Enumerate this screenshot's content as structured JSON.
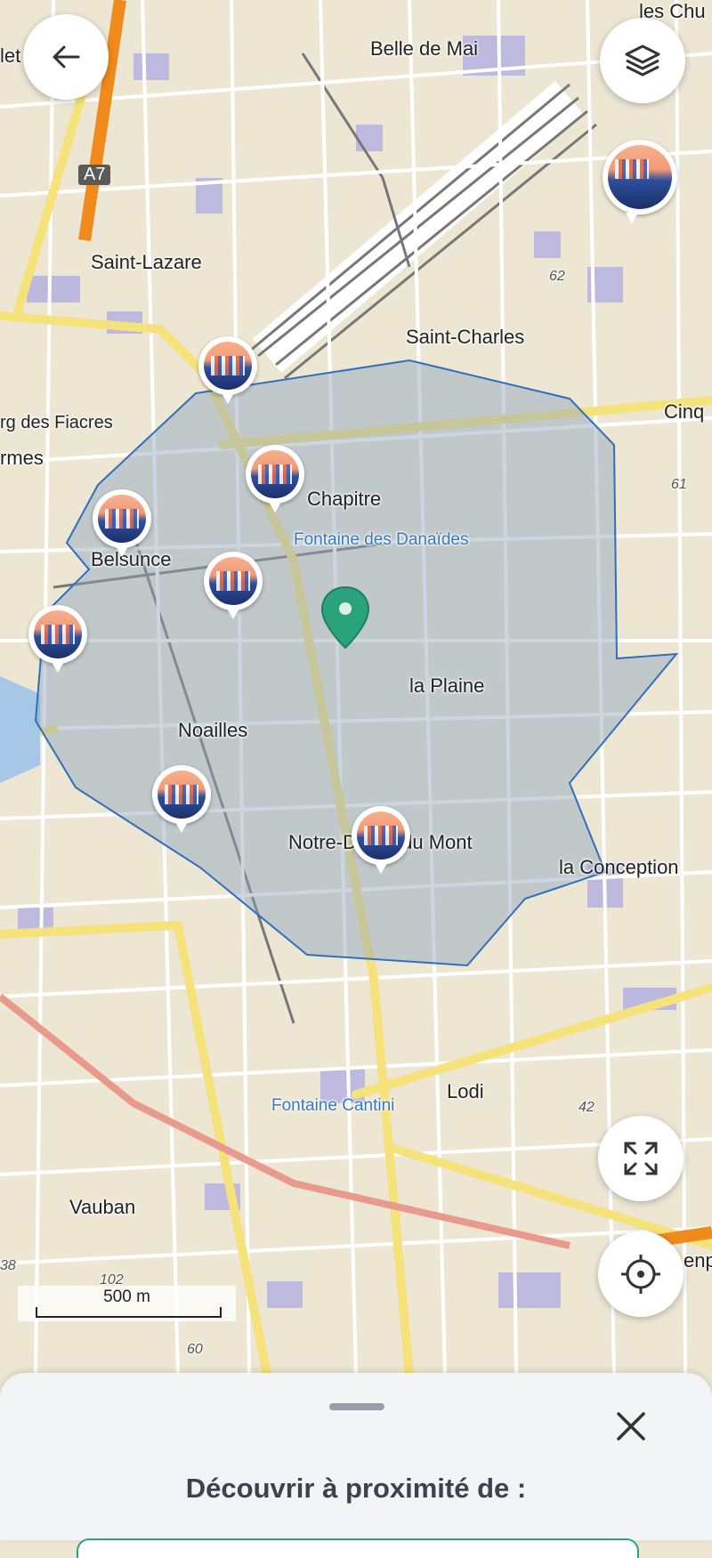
{
  "map": {
    "places": {
      "belle_de_mai": "Belle de Mai",
      "les_chu": "les Chu",
      "saint_lazare": "Saint-Lazare",
      "saint_charles": "Saint-Charles",
      "cinq": "Cinq",
      "fbg_fiacres": "rg des Fiacres",
      "rmes": "rmes",
      "chapitre": "Chapitre",
      "fontaine_danaides": "Fontaine des Danaïdes",
      "belsunce": "Belsunce",
      "la_plaine": "la Plaine",
      "noailles": "Noailles",
      "notre_dame": "Notre-Dame-du Mont",
      "la_conception": "la Conception",
      "lodi": "Lodi",
      "fontaine_cantini": "Fontaine Cantini",
      "vauban": "Vauban",
      "let": "let",
      "enp": "enp"
    },
    "elevations": {
      "e62": "62",
      "e61": "61",
      "e42": "42",
      "e102": "102",
      "e60": "60",
      "e38": "38"
    },
    "road_shield": "A7",
    "scale_label": "500 m",
    "colors": {
      "land": "#ece6d3",
      "zone_fill": "#8fa4bd",
      "zone_stroke": "#2f6fc0",
      "marker": "#2aa37a",
      "highway": "#f08a1c",
      "primary_road": "#f5e27a"
    }
  },
  "controls": {
    "back_icon": "arrow-left-icon",
    "layers_icon": "layers-icon",
    "fullscreen_icon": "expand-icon",
    "locate_icon": "crosshair-icon"
  },
  "sheet": {
    "title": "Découvrir à proximité de :",
    "close_icon": "close-icon"
  }
}
